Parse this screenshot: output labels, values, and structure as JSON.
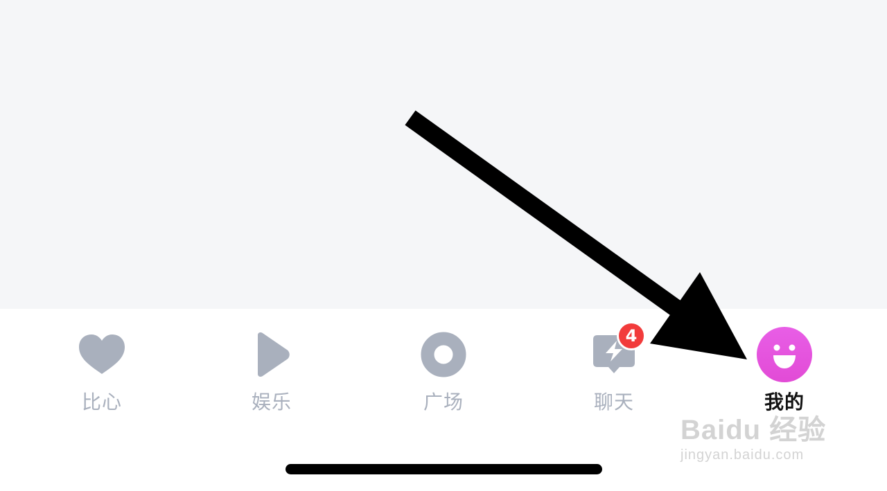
{
  "tabbar": {
    "tabs": [
      {
        "id": "bixin",
        "label": "比心",
        "icon": "heart-icon",
        "active": false
      },
      {
        "id": "yule",
        "label": "娱乐",
        "icon": "play-icon",
        "active": false
      },
      {
        "id": "guangchang",
        "label": "广场",
        "icon": "ring-icon",
        "active": false
      },
      {
        "id": "liaotian",
        "label": "聊天",
        "icon": "lightning-chat-icon",
        "active": false,
        "badge": "4"
      },
      {
        "id": "wode",
        "label": "我的",
        "icon": "smiley-icon",
        "active": true
      }
    ]
  },
  "colors": {
    "inactive_icon": "#a9b0bd",
    "active_icon": "#e552e0",
    "badge": "#f23b3b",
    "content_bg": "#f5f6f8"
  },
  "watermark": {
    "main": "Baidu 经验",
    "sub": "jingyan.baidu.com"
  }
}
